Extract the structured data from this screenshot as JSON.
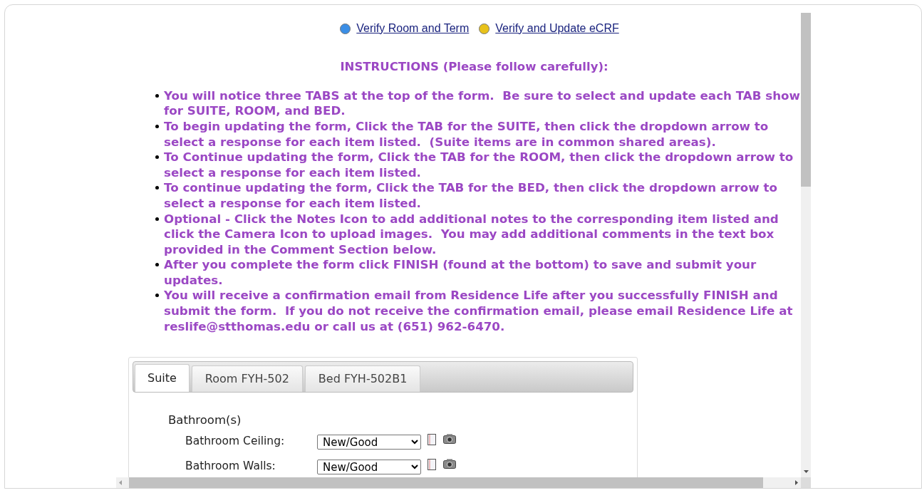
{
  "links": [
    {
      "label": "Verify Room and Term",
      "color": "#3a8ee6"
    },
    {
      "label": "Verify and Update eCRF",
      "color": "#e8c21a"
    }
  ],
  "instructions": {
    "title": "INSTRUCTIONS (Please follow carefully):",
    "items": [
      "You will notice three TABS at the top of the form.  Be sure to select and update each TAB show\nfor SUITE, ROOM, and BED.",
      "To begin updating the form, Click the TAB for the SUITE, then click the dropdown arrow to\nselect a response for each item listed.  (Suite items are in common shared areas).",
      "To Continue updating the form, Click the TAB for the ROOM, then click the dropdown arrow to\nselect a response for each item listed.",
      "To continue updating the form, Click the TAB for the BED, then click the dropdown arrow to\nselect a response for each item listed.",
      "Optional - Click the Notes Icon to add additional notes to the corresponding item listed and\nclick the Camera Icon to upload images.  You may add additional comments in the text box\nprovided in the Comment Section below.",
      "After you complete the form click FINISH (found at the bottom) to save and submit your\nupdates.",
      "You will receive a confirmation email from Residence Life after you successfully FINISH and\nsubmit the form.  If you do not receive the confirmation email, please email Residence Life at\nreslife@stthomas.edu or call us at (651) 962-6470."
    ]
  },
  "tabs": [
    {
      "label": "Suite",
      "selected": true
    },
    {
      "label": "Room FYH-502",
      "selected": false
    },
    {
      "label": "Bed FYH-502B1",
      "selected": false
    }
  ],
  "section": {
    "title": "Bathroom(s)",
    "rows": [
      {
        "label": "Bathroom Ceiling:",
        "value": "New/Good"
      },
      {
        "label": "Bathroom Walls:",
        "value": "New/Good"
      }
    ]
  }
}
